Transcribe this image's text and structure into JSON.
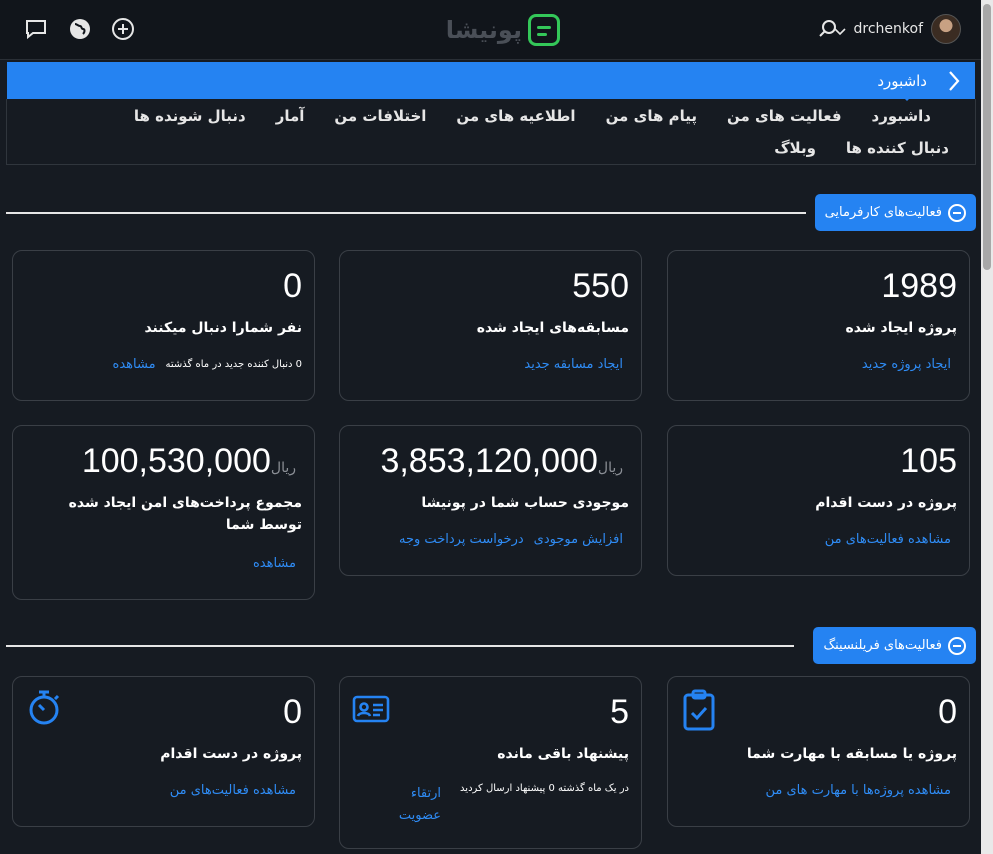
{
  "header": {
    "logo_text": "پونیشا",
    "username": "drchenkof",
    "icons": [
      "chat-icon",
      "globe-icon",
      "plus-circle-icon",
      "search-icon",
      "chevron-down-icon"
    ]
  },
  "breadcrumb": {
    "title": "داشبورد"
  },
  "nav": {
    "row1": [
      "داشبورد",
      "فعالیت های من",
      "پیام های من",
      "اطلاعیه های من",
      "اختلافات من",
      "آمار",
      "دنبال شونده ها"
    ],
    "row2": [
      "دنبال کننده ها",
      "وبلاگ"
    ]
  },
  "sections": {
    "employer": "فعالیت‌های کارفرمایی",
    "freelance": "فعالیت‌های فریلنسینگ"
  },
  "employer_cards": [
    {
      "number": "1989",
      "title": "پروژه ایجاد شده",
      "links": [
        "ایجاد پروژه جدید"
      ]
    },
    {
      "number": "550",
      "title": "مسابقه‌های ایجاد شده",
      "links": [
        "ایجاد مسابقه جدید"
      ]
    },
    {
      "number": "0",
      "title": "نفر شمارا دنبال میکنند",
      "note": "0 دنبال کننده جدید در ماه گذشته",
      "links": [
        "مشاهده"
      ]
    },
    {
      "number": "105",
      "title": "پروژه در دست اقدام",
      "links": [
        "مشاهده فعالیت‌های من"
      ]
    },
    {
      "number": "3,853,120,000",
      "currency": "ریال",
      "title": "موجودی حساب شما در پونیشا",
      "links": [
        "افزایش موجودی",
        "درخواست پرداخت وجه"
      ]
    },
    {
      "number": "100,530,000",
      "currency": "ریال",
      "title": "مجموع پرداخت‌های امن ایجاد شده توسط شما",
      "links": [
        "مشاهده"
      ]
    }
  ],
  "freelance_cards": [
    {
      "number": "0",
      "title": "پروژه یا مسابقه با مهارت شما",
      "links": [
        "مشاهده پروژه‌ها با مهارت های من"
      ],
      "icon": "clipboard-check-icon"
    },
    {
      "number": "5",
      "title": "پیشنهاد باقی مانده",
      "note": "در یک ماه گذشته 0 پیشنهاد ارسال کردید",
      "links": [
        "ارتقاء عضویت"
      ],
      "icon": "id-card-icon"
    },
    {
      "number": "0",
      "title": "پروژه در دست اقدام",
      "links": [
        "مشاهده فعالیت‌های من"
      ],
      "icon": "stopwatch-icon"
    }
  ],
  "colors": {
    "accent": "#2583f2",
    "background": "#161b22",
    "logo_green": "#34c759"
  }
}
